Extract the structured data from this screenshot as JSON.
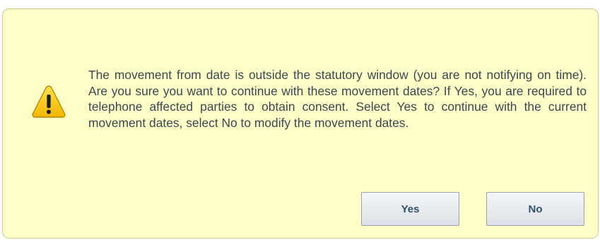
{
  "dialog": {
    "icon": "warning-icon",
    "message": "The movement from date is outside the statutory window (you are not notifying on time). Are you sure you want to continue with these movement dates? If Yes, you are required to telephone affected parties to obtain consent. Select Yes to continue with the current movement dates, select No to modify the movement dates.",
    "buttons": {
      "yes_label": "Yes",
      "no_label": "No"
    }
  },
  "colors": {
    "dialog_background": "#ffffc8",
    "text": "#3c4650",
    "button_text": "#2f4f6b",
    "warning_fill": "#f5c400"
  }
}
